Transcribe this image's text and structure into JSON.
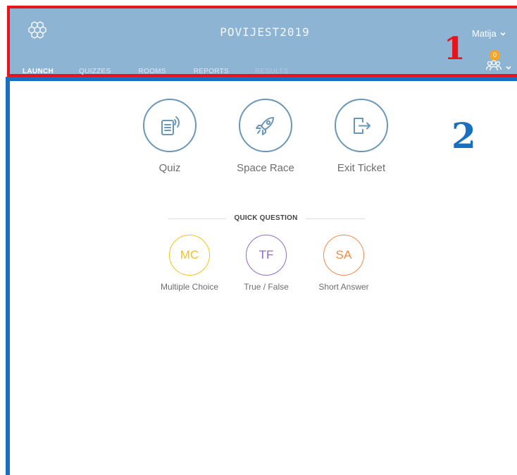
{
  "header": {
    "app_title": "POVIJEST2019",
    "user_name": "Matija",
    "students_count": "0",
    "annotation_label": "1",
    "logo_icon": "hexagon-cluster-icon",
    "people_icon": "students-group-icon"
  },
  "tabs": [
    {
      "label": "LAUNCH",
      "state": "active"
    },
    {
      "label": "QUIZZES",
      "state": "normal"
    },
    {
      "label": "ROOMS",
      "state": "normal"
    },
    {
      "label": "REPORTS",
      "state": "normal"
    },
    {
      "label": "RESULTS",
      "state": "disabled"
    }
  ],
  "main": {
    "annotation_label": "2",
    "launch_options": [
      {
        "label": "Quiz",
        "icon": "quiz-document-icon"
      },
      {
        "label": "Space Race",
        "icon": "rocket-icon"
      },
      {
        "label": "Exit Ticket",
        "icon": "exit-door-icon"
      }
    ],
    "quick_question": {
      "title": "QUICK QUESTION",
      "options": [
        {
          "abbr": "MC",
          "label": "Multiple Choice",
          "color": "#f3c31f"
        },
        {
          "abbr": "TF",
          "label": "True / False",
          "color": "#8e6bc8"
        },
        {
          "abbr": "SA",
          "label": "Short Answer",
          "color": "#f28a4a"
        }
      ]
    }
  },
  "colors": {
    "header_bg": "#8eb4d4",
    "annotation_red": "#e8141b",
    "annotation_blue": "#1a6fc1",
    "launch_icon": "#6a97b8",
    "badge": "#f5a623"
  }
}
